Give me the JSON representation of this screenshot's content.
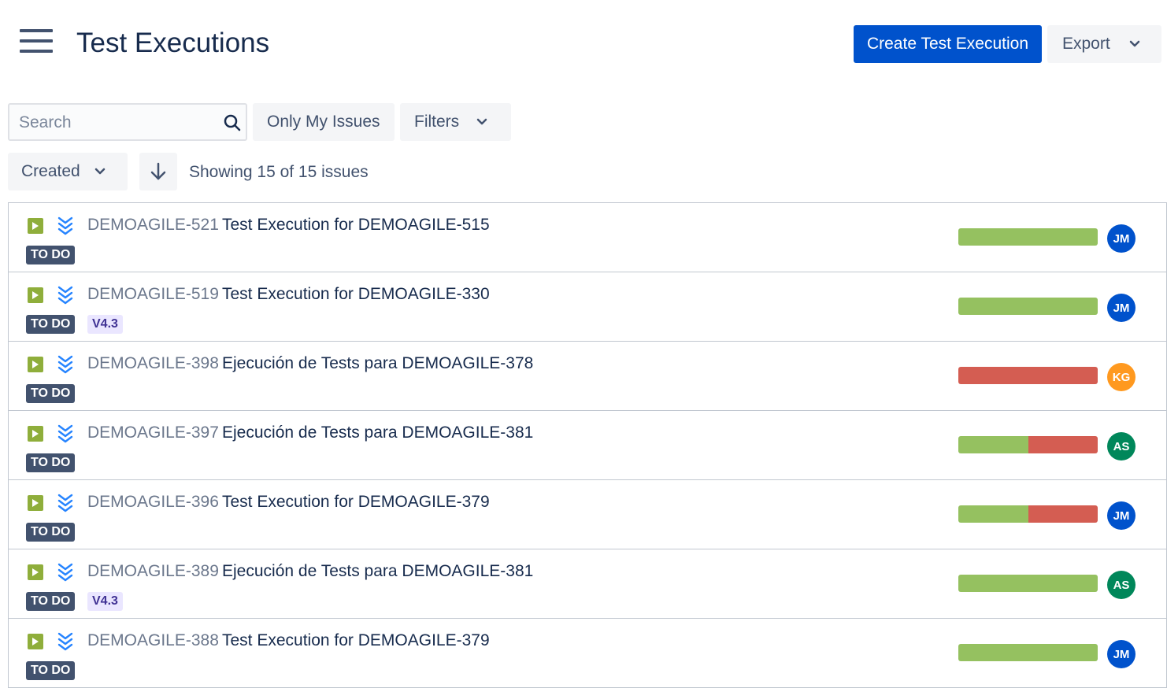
{
  "header": {
    "title": "Test Executions",
    "create_button": "Create Test Execution",
    "export_button": "Export"
  },
  "toolbar": {
    "search_placeholder": "Search",
    "only_my_issues": "Only My Issues",
    "filters": "Filters",
    "sort_field": "Created",
    "showing_text": "Showing 15 of 15 issues"
  },
  "colors": {
    "primary": "#0052cc",
    "pass": "#95c160",
    "fail": "#d45d52",
    "status_todo": "#42526e",
    "version_bg": "#eae6ff",
    "version_fg": "#403294"
  },
  "issues": [
    {
      "key": "DEMOAGILE-521",
      "summary": "Test Execution for DEMOAGILE-515",
      "status": "TO DO",
      "version": "",
      "pass_fraction": 1.0,
      "assignee": "JM",
      "avatar_color": "#0052cc"
    },
    {
      "key": "DEMOAGILE-519",
      "summary": "Test Execution for DEMOAGILE-330",
      "status": "TO DO",
      "version": "V4.3",
      "pass_fraction": 1.0,
      "assignee": "JM",
      "avatar_color": "#0052cc"
    },
    {
      "key": "DEMOAGILE-398",
      "summary": "Ejecución de Tests para DEMOAGILE-378",
      "status": "TO DO",
      "version": "",
      "pass_fraction": 0.0,
      "assignee": "KG",
      "avatar_color": "#ff991f"
    },
    {
      "key": "DEMOAGILE-397",
      "summary": "Ejecución de Tests para DEMOAGILE-381",
      "status": "TO DO",
      "version": "",
      "pass_fraction": 0.5,
      "assignee": "AS",
      "avatar_color": "#00875a"
    },
    {
      "key": "DEMOAGILE-396",
      "summary": "Test Execution for DEMOAGILE-379",
      "status": "TO DO",
      "version": "",
      "pass_fraction": 0.5,
      "assignee": "JM",
      "avatar_color": "#0052cc"
    },
    {
      "key": "DEMOAGILE-389",
      "summary": "Ejecución de Tests para DEMOAGILE-381",
      "status": "TO DO",
      "version": "V4.3",
      "pass_fraction": 1.0,
      "assignee": "AS",
      "avatar_color": "#00875a"
    },
    {
      "key": "DEMOAGILE-388",
      "summary": "Test Execution for DEMOAGILE-379",
      "status": "TO DO",
      "version": "",
      "pass_fraction": 1.0,
      "assignee": "JM",
      "avatar_color": "#0052cc"
    }
  ]
}
